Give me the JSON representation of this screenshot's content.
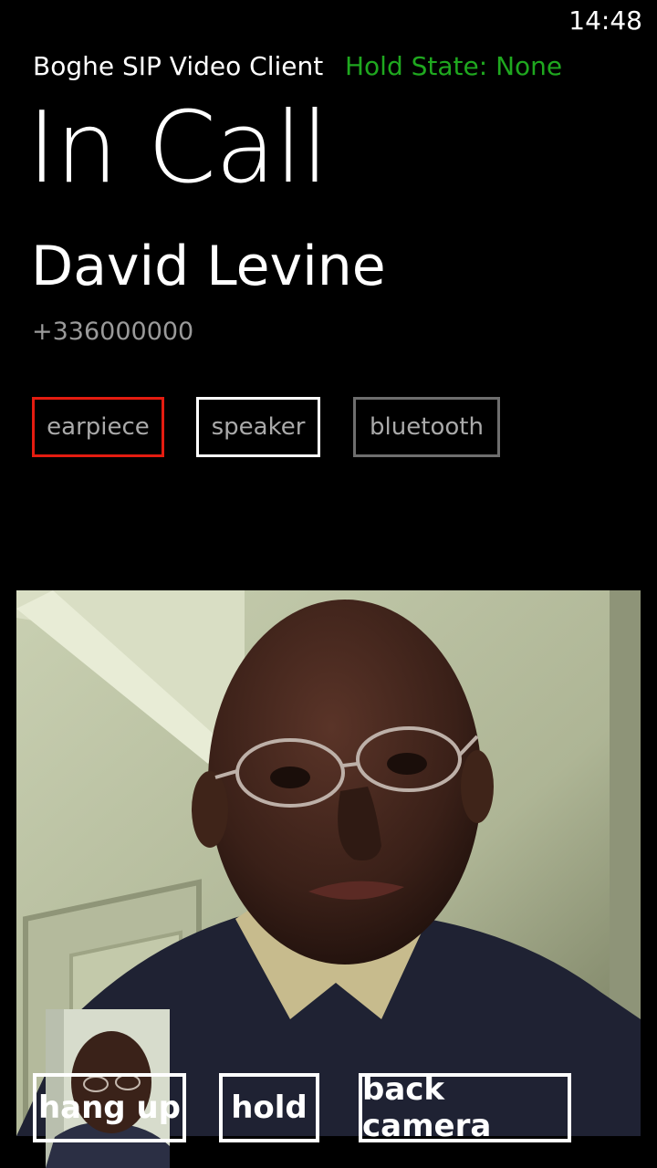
{
  "status_bar": {
    "time": "14:48"
  },
  "header": {
    "app_title": "Boghe SIP Video Client",
    "hold_state": "Hold State: None",
    "hold_state_color": "#1fa81f"
  },
  "page_title": "In Call",
  "caller": {
    "name": "David Levine",
    "number": "+336000000"
  },
  "audio_routes": {
    "earpiece": "earpiece",
    "speaker": "speaker",
    "bluetooth": "bluetooth",
    "selected": "earpiece",
    "selected_color": "#e41c10"
  },
  "call_actions": {
    "hang_up": "hang up",
    "hold": "hold",
    "back_camera": "back camera"
  }
}
